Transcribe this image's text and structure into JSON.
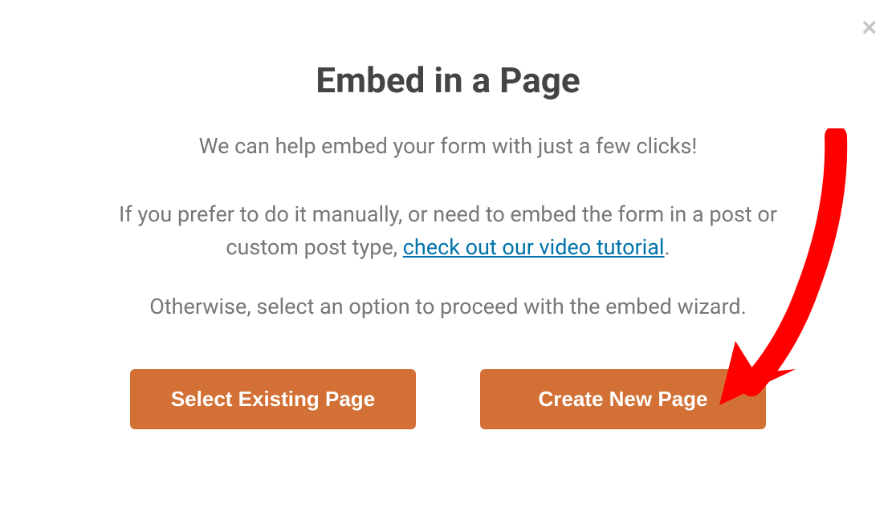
{
  "modal": {
    "title": "Embed in a Page",
    "subtitle": "We can help embed your form with just a few clicks!",
    "description_prefix": "If you prefer to do it manually, or need to embed the form in a post or custom post type, ",
    "tutorial_link_text": "check out our video tutorial",
    "description_suffix": ".",
    "instruction": "Otherwise, select an option to proceed with the embed wizard.",
    "buttons": {
      "select_existing": "Select Existing Page",
      "create_new": "Create New Page"
    }
  }
}
